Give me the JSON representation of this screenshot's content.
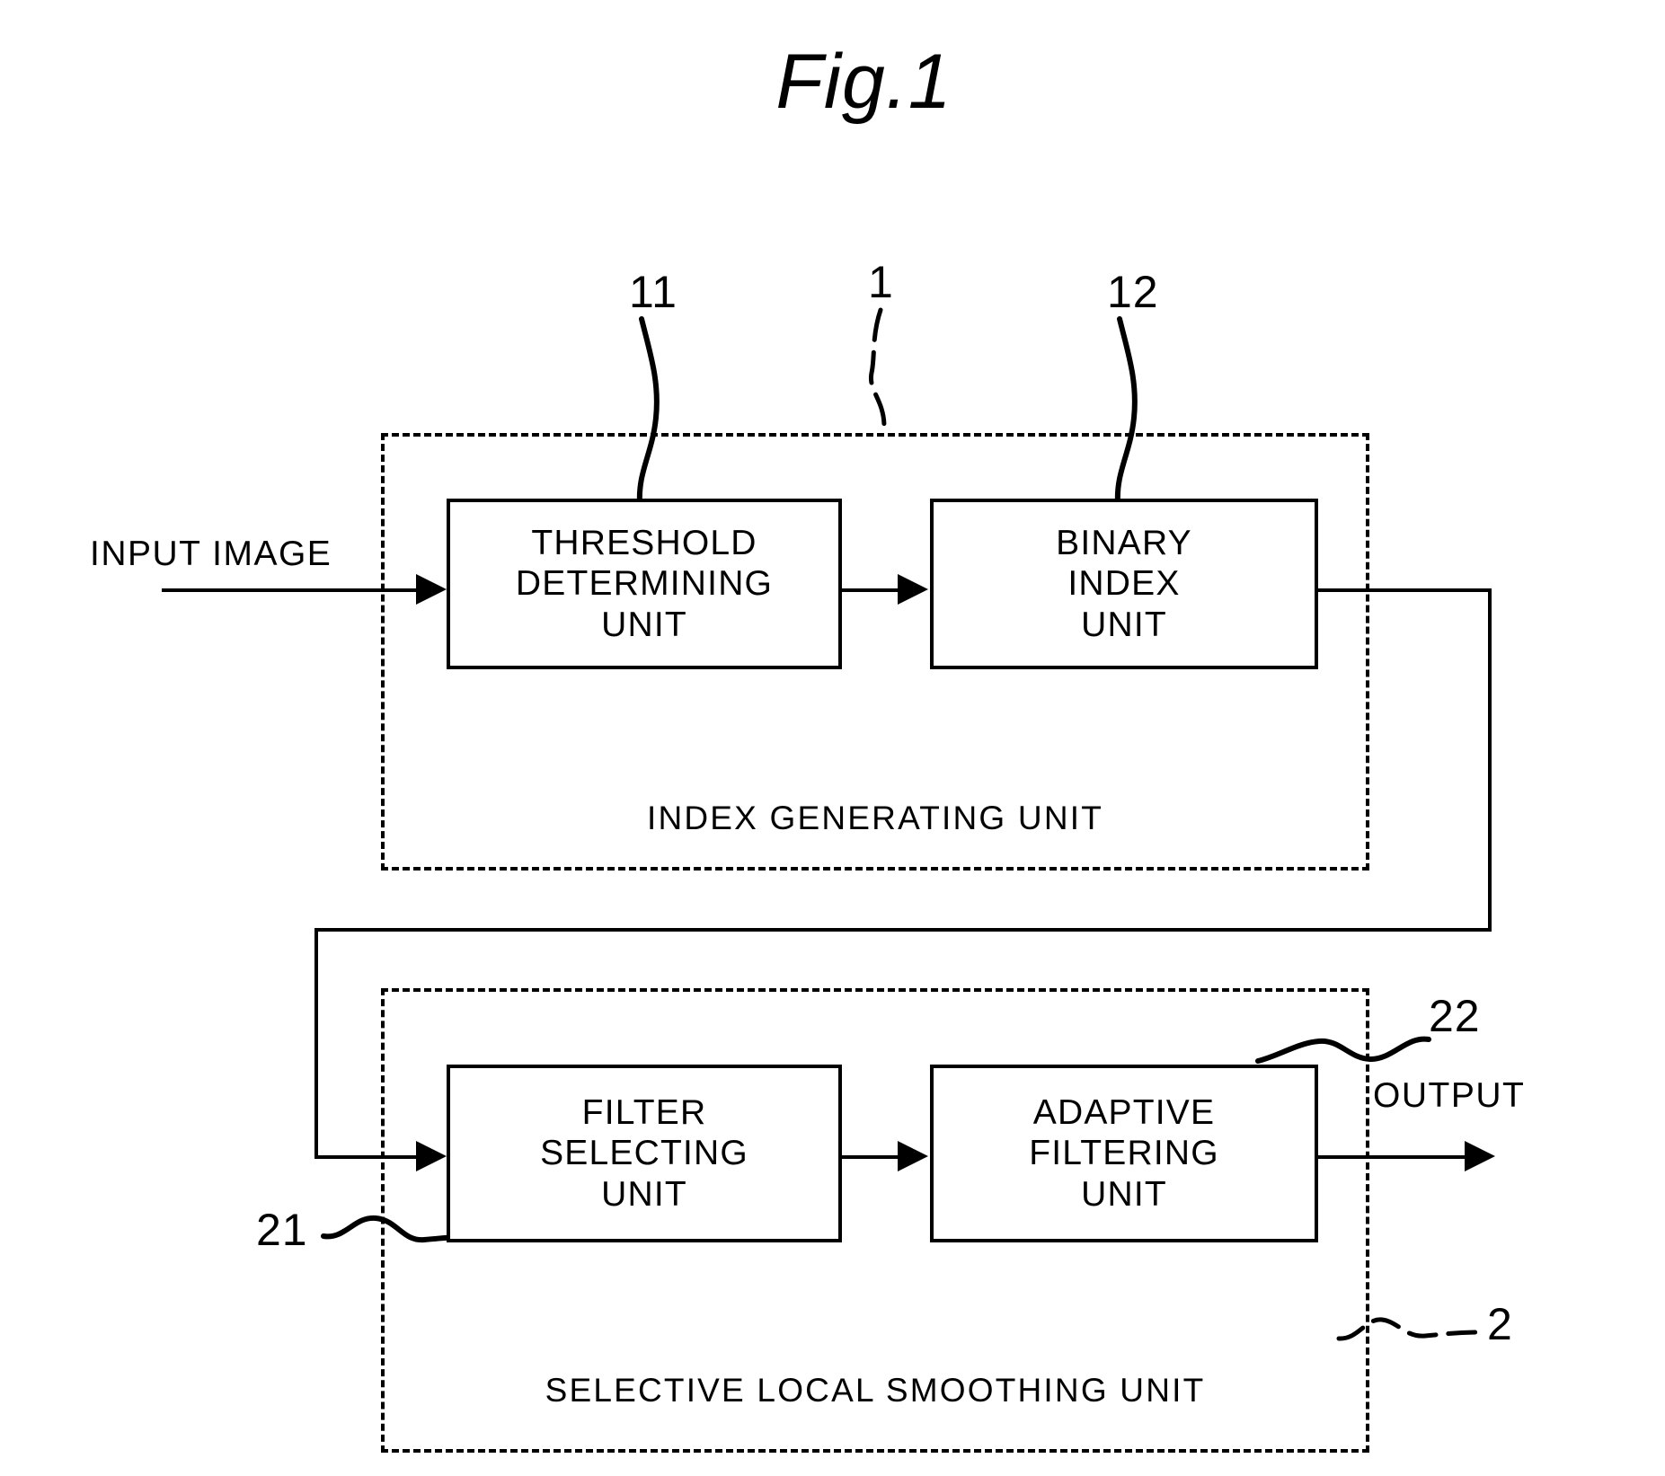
{
  "figure": {
    "title": "Fig.1"
  },
  "labels": {
    "input_image": "INPUT  IMAGE",
    "output": "OUTPUT"
  },
  "groups": [
    {
      "id": "index-generating-unit",
      "label": "INDEX  GENERATING  UNIT",
      "ref": "1"
    },
    {
      "id": "selective-local-smoothing-unit",
      "label": "SELECTIVE  LOCAL  SMOOTHING  UNIT",
      "ref": "2"
    }
  ],
  "units": [
    {
      "id": "threshold-determining-unit",
      "ref": "11",
      "lines": [
        "THRESHOLD",
        "DETERMINING",
        "UNIT"
      ]
    },
    {
      "id": "binary-index-unit",
      "ref": "12",
      "lines": [
        "BINARY",
        "INDEX",
        "UNIT"
      ]
    },
    {
      "id": "filter-selecting-unit",
      "ref": "21",
      "lines": [
        "FILTER",
        "SELECTING",
        "UNIT"
      ]
    },
    {
      "id": "adaptive-filtering-unit",
      "ref": "22",
      "lines": [
        "ADAPTIVE",
        "FILTERING",
        "UNIT"
      ]
    }
  ],
  "refs": {
    "r1": "1",
    "r2": "2",
    "r11": "11",
    "r12": "12",
    "r21": "21",
    "r22": "22"
  },
  "colors": {
    "ink": "#000000",
    "paper": "#ffffff"
  }
}
